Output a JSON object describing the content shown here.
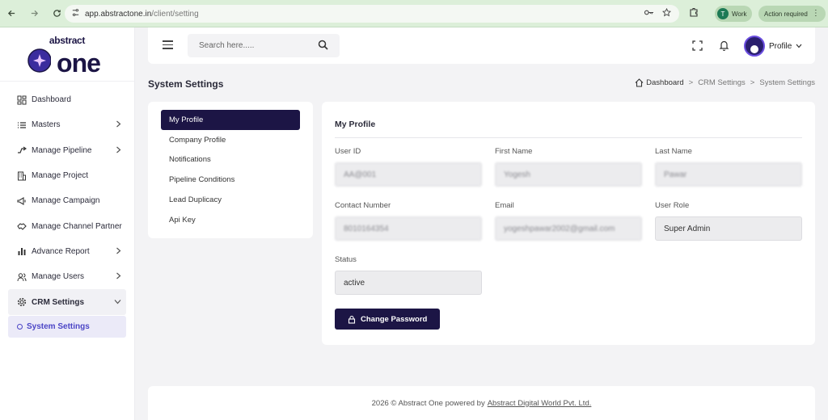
{
  "browser": {
    "url_host": "app.abstractone.in",
    "url_path": "/client/setting",
    "work_label": "Work",
    "work_initial": "T",
    "action_label": "Action required"
  },
  "logo": {
    "line1": "abstract",
    "line2": "one"
  },
  "sidebar": {
    "items": [
      {
        "label": "Dashboard",
        "icon": "grid-icon",
        "chevron": false
      },
      {
        "label": "Masters",
        "icon": "list-icon",
        "chevron": true
      },
      {
        "label": "Manage Pipeline",
        "icon": "pipeline-icon",
        "chevron": true
      },
      {
        "label": "Manage Project",
        "icon": "building-icon",
        "chevron": false
      },
      {
        "label": "Manage Campaign",
        "icon": "megaphone-icon",
        "chevron": false
      },
      {
        "label": "Manage Channel Partner",
        "icon": "handshake-icon",
        "chevron": false
      },
      {
        "label": "Advance Report",
        "icon": "bar-chart-icon",
        "chevron": true
      },
      {
        "label": "Manage Users",
        "icon": "users-icon",
        "chevron": true
      },
      {
        "label": "CRM Settings",
        "icon": "gear-icon",
        "chevron": true
      }
    ],
    "sub_item": "System Settings"
  },
  "header": {
    "search_placeholder": "Search here.....",
    "profile_label": "Profile"
  },
  "page": {
    "title": "System Settings",
    "breadcrumb": [
      "Dashboard",
      "CRM Settings",
      "System Settings"
    ]
  },
  "settings_nav": [
    "My Profile",
    "Company Profile",
    "Notifications",
    "Pipeline Conditions",
    "Lead Duplicacy",
    "Api Key"
  ],
  "profile": {
    "title": "My Profile",
    "fields": {
      "user_id": {
        "label": "User ID",
        "value": "AA@001"
      },
      "first_name": {
        "label": "First Name",
        "value": "Yogesh"
      },
      "last_name": {
        "label": "Last Name",
        "value": "Pawar"
      },
      "contact": {
        "label": "Contact Number",
        "value": "8010164354"
      },
      "email": {
        "label": "Email",
        "value": "yogeshpawar2002@gmail.com"
      },
      "role": {
        "label": "User Role",
        "value": "Super Admin"
      },
      "status": {
        "label": "Status",
        "value": "active"
      }
    },
    "change_password": "Change Password"
  },
  "footer": {
    "text": "2026 © Abstract One powered by",
    "link": "Abstract Digital World Pvt. Ltd."
  },
  "colors": {
    "brand_dark": "#1c1545",
    "accent": "#4b45c6",
    "browser": "#dcefd9"
  }
}
